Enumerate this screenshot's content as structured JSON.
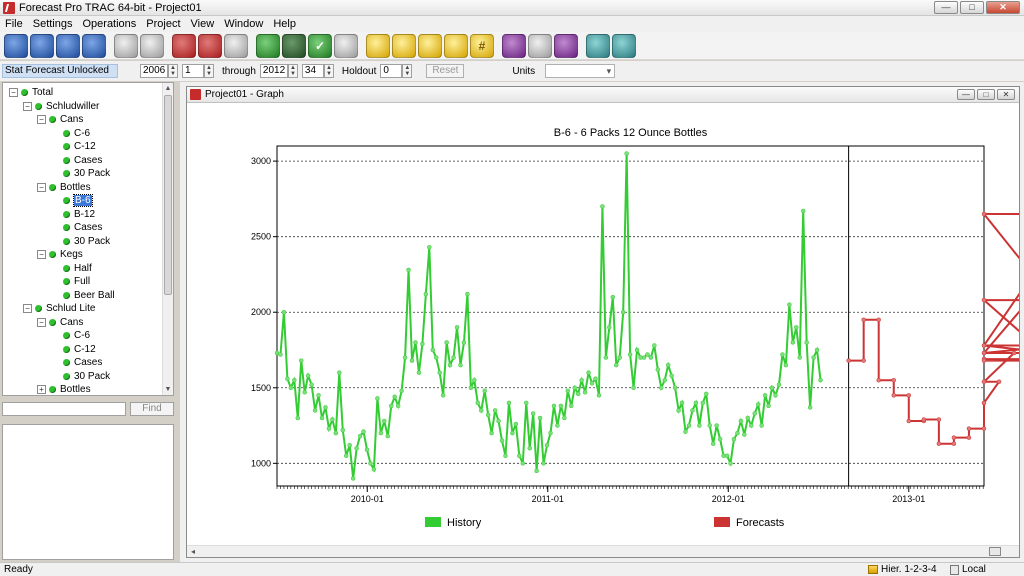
{
  "window": {
    "title": "Forecast Pro TRAC 64-bit - Project01",
    "buttons": {
      "minimize": "—",
      "maximize": "□",
      "close": "✕"
    }
  },
  "menu": [
    "File",
    "Settings",
    "Operations",
    "Project",
    "View",
    "Window",
    "Help"
  ],
  "toolbar": {
    "icons": [
      {
        "name": "new-icon",
        "glyph": "",
        "color": "blue"
      },
      {
        "name": "open-icon",
        "glyph": "",
        "color": "blue"
      },
      {
        "name": "save-icon",
        "glyph": "",
        "color": "blue"
      },
      {
        "name": "print-icon",
        "glyph": "",
        "color": "blue"
      },
      {
        "name": "copy-icon",
        "glyph": "",
        "color": "gray"
      },
      {
        "name": "paste-icon",
        "glyph": "",
        "color": "gray"
      },
      {
        "name": "report-icon",
        "glyph": "",
        "color": "red"
      },
      {
        "name": "forecast-icon",
        "glyph": "",
        "color": "red"
      },
      {
        "name": "tools-icon",
        "glyph": "",
        "color": "gray"
      },
      {
        "name": "override-icon",
        "glyph": "",
        "color": "green"
      },
      {
        "name": "graph-icon",
        "glyph": "",
        "color": "dkgreen"
      },
      {
        "name": "check-icon",
        "glyph": "✓",
        "color": "green"
      },
      {
        "name": "paw-icon",
        "glyph": "",
        "color": "gray"
      },
      {
        "name": "note-icon",
        "glyph": "",
        "color": "yellow"
      },
      {
        "name": "flag-icon",
        "glyph": "",
        "color": "yellow"
      },
      {
        "name": "edit-icon",
        "glyph": "",
        "color": "yellow"
      },
      {
        "name": "pencil-icon",
        "glyph": "",
        "color": "yellow"
      },
      {
        "name": "hash-icon",
        "glyph": "#",
        "color": "yellow"
      },
      {
        "name": "database-icon",
        "glyph": "",
        "color": "purple"
      },
      {
        "name": "network-icon",
        "glyph": "",
        "color": "gray"
      },
      {
        "name": "export-icon",
        "glyph": "",
        "color": "purple"
      },
      {
        "name": "filter-icon",
        "glyph": "",
        "color": "teal"
      },
      {
        "name": "wrench-icon",
        "glyph": "",
        "color": "teal"
      }
    ]
  },
  "params": {
    "status": "Stat Forecast Unlocked",
    "start_year": "2006",
    "start_period": "1",
    "through_label": "through",
    "end_year": "2012",
    "end_period": "34",
    "holdout_label": "Holdout",
    "holdout": "0",
    "reset_label": "Reset",
    "units_label": "Units",
    "units_value": ""
  },
  "tree": {
    "nodes": [
      {
        "label": "Total",
        "level": 0,
        "expander": "−"
      },
      {
        "label": "Schludwiller",
        "level": 1,
        "expander": "−"
      },
      {
        "label": "Cans",
        "level": 2,
        "expander": "−"
      },
      {
        "label": "C-6",
        "level": 3,
        "expander": ""
      },
      {
        "label": "C-12",
        "level": 3,
        "expander": ""
      },
      {
        "label": "Cases",
        "level": 3,
        "expander": ""
      },
      {
        "label": "30 Pack",
        "level": 3,
        "expander": ""
      },
      {
        "label": "Bottles",
        "level": 2,
        "expander": "−"
      },
      {
        "label": "B-6",
        "level": 3,
        "expander": "",
        "selected": true
      },
      {
        "label": "B-12",
        "level": 3,
        "expander": ""
      },
      {
        "label": "Cases",
        "level": 3,
        "expander": ""
      },
      {
        "label": "30 Pack",
        "level": 3,
        "expander": ""
      },
      {
        "label": "Kegs",
        "level": 2,
        "expander": "−"
      },
      {
        "label": "Half",
        "level": 3,
        "expander": ""
      },
      {
        "label": "Full",
        "level": 3,
        "expander": ""
      },
      {
        "label": "Beer Ball",
        "level": 3,
        "expander": ""
      },
      {
        "label": "Schlud Lite",
        "level": 1,
        "expander": "−"
      },
      {
        "label": "Cans",
        "level": 2,
        "expander": "−"
      },
      {
        "label": "C-6",
        "level": 3,
        "expander": ""
      },
      {
        "label": "C-12",
        "level": 3,
        "expander": ""
      },
      {
        "label": "Cases",
        "level": 3,
        "expander": ""
      },
      {
        "label": "30 Pack",
        "level": 3,
        "expander": ""
      },
      {
        "label": "Bottles",
        "level": 2,
        "expander": "+"
      }
    ]
  },
  "find": {
    "value": "",
    "button_label": "Find"
  },
  "graph_window": {
    "title": "Project01 - Graph"
  },
  "chart_data": {
    "type": "line",
    "title": "B-6 - 6 Packs 12 Ounce Bottles",
    "xlabel": "",
    "ylabel": "",
    "x_range": [
      "2009-07",
      "2013-06"
    ],
    "forecast_start": "2012-09",
    "ylim": [
      850,
      3100
    ],
    "yticks": [
      1000,
      1500,
      2000,
      2500,
      3000
    ],
    "xticks": [
      "2010-01",
      "2011-01",
      "2012-01",
      "2013-01"
    ],
    "grid": "horizontal-dashed",
    "legend_position": "bottom",
    "colors": {
      "history": "#33cc33",
      "forecast": "#cc3333"
    },
    "series": [
      {
        "name": "History",
        "frequency": "weekly",
        "start": "2009-07-01",
        "values": [
          1730,
          1720,
          2000,
          1560,
          1500,
          1550,
          1300,
          1680,
          1470,
          1580,
          1520,
          1350,
          1450,
          1300,
          1370,
          1230,
          1290,
          1200,
          1600,
          1220,
          1050,
          1120,
          900,
          1100,
          1180,
          1210,
          1090,
          1000,
          960,
          1430,
          1200,
          1280,
          1180,
          1380,
          1440,
          1380,
          1480,
          1700,
          2280,
          1680,
          1800,
          1600,
          1790,
          2120,
          2430,
          1750,
          1700,
          1600,
          1450,
          1800,
          1650,
          1700,
          1900,
          1650,
          1800,
          2120,
          1500,
          1550,
          1400,
          1350,
          1480,
          1320,
          1200,
          1350,
          1280,
          1150,
          1050,
          1400,
          1200,
          1260,
          1050,
          1000,
          1400,
          1100,
          1330,
          950,
          1300,
          1000,
          1120,
          1200,
          1380,
          1250,
          1380,
          1300,
          1480,
          1380,
          1500,
          1460,
          1550,
          1470,
          1600,
          1530,
          1560,
          1450,
          2700,
          1700,
          1900,
          2100,
          1650,
          1700,
          2000,
          3050,
          1720,
          1500,
          1750,
          1700,
          1700,
          1720,
          1700,
          1780,
          1620,
          1500,
          1550,
          1650,
          1580,
          1500,
          1350,
          1400,
          1210,
          1250,
          1350,
          1400,
          1250,
          1400,
          1460,
          1250,
          1130,
          1250,
          1160,
          1050,
          1050,
          1000,
          1160,
          1200,
          1280,
          1190,
          1300,
          1250,
          1330,
          1390,
          1250,
          1450,
          1380,
          1500,
          1450,
          1520,
          1720,
          1650,
          2050,
          1800,
          1900,
          1700,
          2670,
          1800,
          1370,
          1700,
          1750,
          1550
        ]
      },
      {
        "name": "Forecasts",
        "frequency": "monthly",
        "start": "2012-09",
        "steps": [
          1680,
          1950,
          1550,
          1450,
          1280,
          1290,
          1130,
          1170,
          1230,
          1400,
          1540,
          1730,
          2080,
          1730,
          1780,
          2650,
          1780,
          1690,
          1680
        ]
      }
    ]
  },
  "status_bar": {
    "left": "Ready",
    "hier": "Hier. 1-2-3-4",
    "location": "Local"
  }
}
